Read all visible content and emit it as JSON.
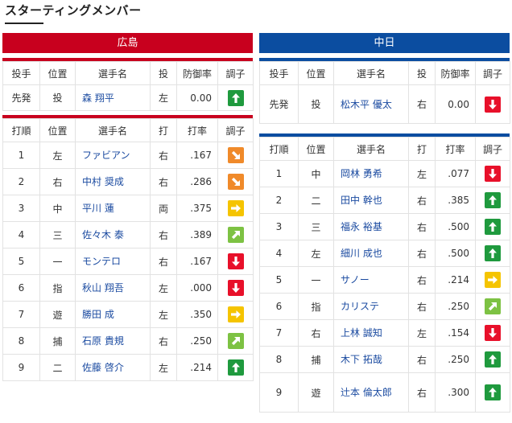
{
  "page": {
    "title": "スターティングメンバー"
  },
  "colors": {
    "home": "#c8001e",
    "away": "#0b4da0",
    "up": "#1f9a3e",
    "down": "#e8102a",
    "flat": "#f5c400",
    "up_slight": "#7dc243",
    "down_slight": "#f08a2a"
  },
  "home": {
    "team_name": "広島",
    "pitcher_headers": [
      "投手",
      "位置",
      "選手名",
      "投",
      "防御率",
      "調子"
    ],
    "pitcher": {
      "role": "先発",
      "pos": "投",
      "name": "森 翔平",
      "hand": "左",
      "era": "0.00",
      "form": "up-icon"
    },
    "batter_headers": [
      "打順",
      "位置",
      "選手名",
      "打",
      "打率",
      "調子"
    ],
    "batters": [
      {
        "order": "1",
        "pos": "左",
        "name": "ファビアン",
        "hand": "右",
        "avg": ".167",
        "form": "down-right-icon"
      },
      {
        "order": "2",
        "pos": "右",
        "name": "中村 奨成",
        "hand": "右",
        "avg": ".286",
        "form": "down-right-icon"
      },
      {
        "order": "3",
        "pos": "中",
        "name": "平川 蓮",
        "hand": "両",
        "avg": ".375",
        "form": "right-icon"
      },
      {
        "order": "4",
        "pos": "三",
        "name": "佐々木 泰",
        "hand": "右",
        "avg": ".389",
        "form": "up-right-icon"
      },
      {
        "order": "5",
        "pos": "一",
        "name": "モンテロ",
        "hand": "右",
        "avg": ".167",
        "form": "down-icon"
      },
      {
        "order": "6",
        "pos": "指",
        "name": "秋山 翔吾",
        "hand": "左",
        "avg": ".000",
        "form": "down-icon"
      },
      {
        "order": "7",
        "pos": "遊",
        "name": "勝田 成",
        "hand": "左",
        "avg": ".350",
        "form": "right-icon"
      },
      {
        "order": "8",
        "pos": "捕",
        "name": "石原 貴規",
        "hand": "右",
        "avg": ".250",
        "form": "up-right-icon"
      },
      {
        "order": "9",
        "pos": "二",
        "name": "佐藤 啓介",
        "hand": "左",
        "avg": ".214",
        "form": "up-icon"
      }
    ]
  },
  "away": {
    "team_name": "中日",
    "pitcher_headers": [
      "投手",
      "位置",
      "選手名",
      "投",
      "防御率",
      "調子"
    ],
    "pitcher": {
      "role": "先発",
      "pos": "投",
      "name": "松木平 優太",
      "hand": "右",
      "era": "0.00",
      "form": "down-icon"
    },
    "batter_headers": [
      "打順",
      "位置",
      "選手名",
      "打",
      "打率",
      "調子"
    ],
    "batters": [
      {
        "order": "1",
        "pos": "中",
        "name": "岡林 勇希",
        "hand": "左",
        "avg": ".077",
        "form": "down-icon"
      },
      {
        "order": "2",
        "pos": "二",
        "name": "田中 幹也",
        "hand": "右",
        "avg": ".385",
        "form": "up-icon"
      },
      {
        "order": "3",
        "pos": "三",
        "name": "福永 裕基",
        "hand": "右",
        "avg": ".500",
        "form": "up-icon"
      },
      {
        "order": "4",
        "pos": "左",
        "name": "細川 成也",
        "hand": "右",
        "avg": ".500",
        "form": "up-icon"
      },
      {
        "order": "5",
        "pos": "一",
        "name": "サノー",
        "hand": "右",
        "avg": ".214",
        "form": "right-icon"
      },
      {
        "order": "6",
        "pos": "指",
        "name": "カリステ",
        "hand": "右",
        "avg": ".250",
        "form": "up-right-icon"
      },
      {
        "order": "7",
        "pos": "右",
        "name": "上林 誠知",
        "hand": "左",
        "avg": ".154",
        "form": "down-icon"
      },
      {
        "order": "8",
        "pos": "捕",
        "name": "木下 拓哉",
        "hand": "右",
        "avg": ".250",
        "form": "up-icon"
      },
      {
        "order": "9",
        "pos": "遊",
        "name": "辻本 倫太郎",
        "hand": "右",
        "avg": ".300",
        "form": "up-icon"
      }
    ]
  }
}
